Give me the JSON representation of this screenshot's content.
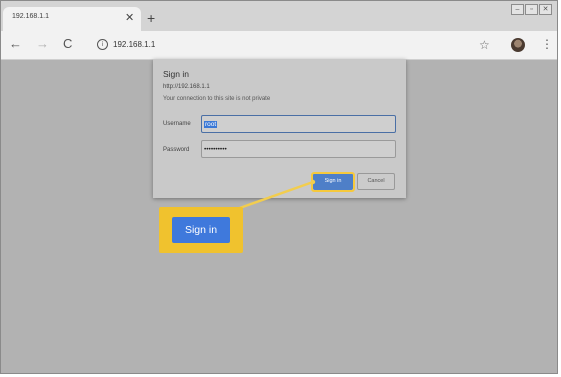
{
  "tab": {
    "title": "192.168.1.1",
    "close": "✕",
    "new_tab": "+"
  },
  "window_controls": {
    "minimize": "–",
    "restore": "▫",
    "close": "✕"
  },
  "toolbar": {
    "back": "←",
    "forward": "→",
    "reload": "C",
    "info": "i",
    "url": "192.168.1.1",
    "bookmark": "☆",
    "menu": "⋮"
  },
  "dialog": {
    "title": "Sign in",
    "url": "http://192.168.1.1",
    "note": "Your connection to this site is not private",
    "username_label": "Username",
    "username_value": "root",
    "password_label": "Password",
    "password_value": "••••••••••",
    "signin_label": "Sign in",
    "cancel_label": "Cancel"
  },
  "callout": {
    "label": "Sign in"
  },
  "colors": {
    "accent_blue": "#3f79dc",
    "highlight_yellow": "#f0c22e",
    "overlay_gray": "#b2b2b2"
  }
}
